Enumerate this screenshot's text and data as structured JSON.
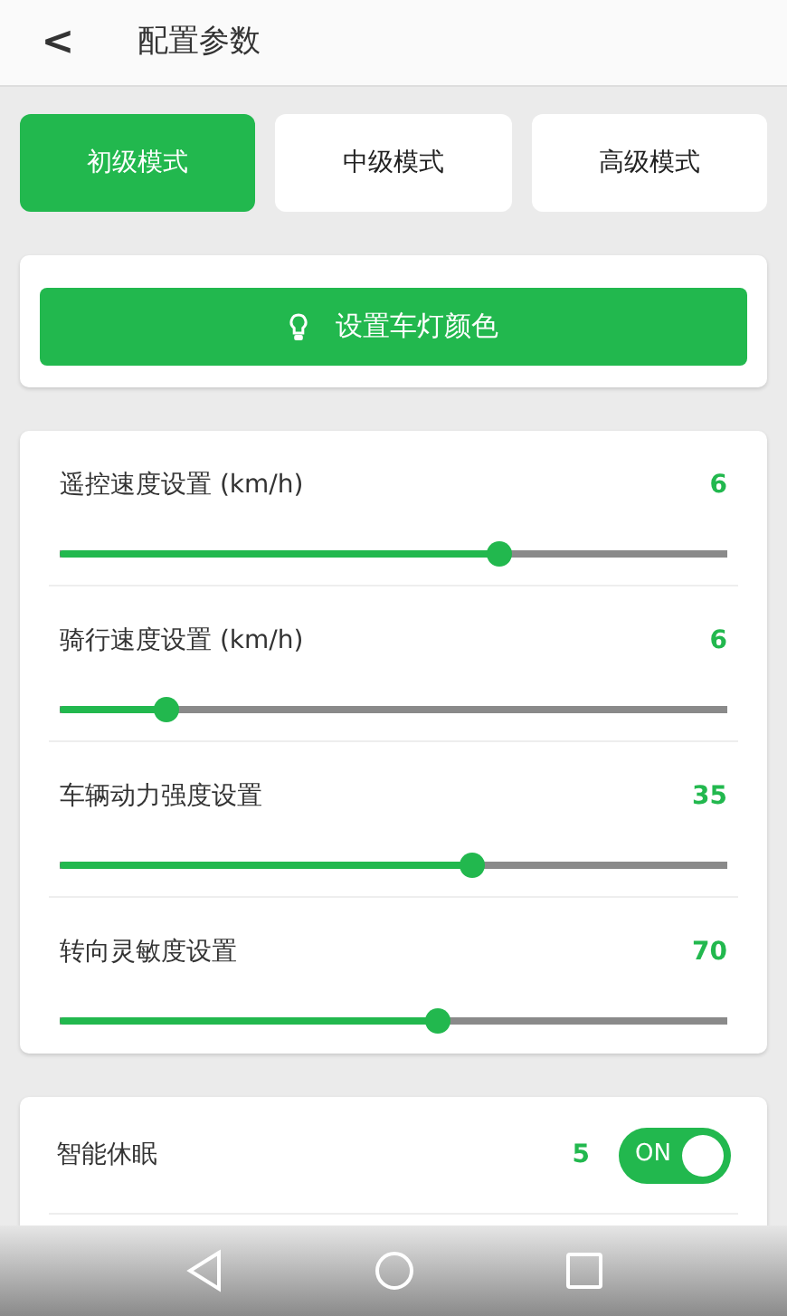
{
  "header": {
    "back": "<",
    "title": "配置参数"
  },
  "modes": [
    {
      "label": "初级模式",
      "selected": true
    },
    {
      "label": "中级模式",
      "selected": false
    },
    {
      "label": "高级模式",
      "selected": false
    }
  ],
  "light_button": {
    "label": "设置车灯颜色"
  },
  "sliders": [
    {
      "label": "遥控速度设置 (km/h)",
      "value": "6",
      "level": 0.665
    },
    {
      "label": "骑行速度设置 (km/h)",
      "value": "6",
      "level": 0.146
    },
    {
      "label": "车辆动力强度设置",
      "value": "35",
      "level": 0.622
    },
    {
      "label": "转向灵敏度设置",
      "value": "70",
      "level": 0.569
    }
  ],
  "sleep": {
    "label": "智能休眠",
    "value": "5",
    "on": true,
    "switch_text": "ON"
  }
}
